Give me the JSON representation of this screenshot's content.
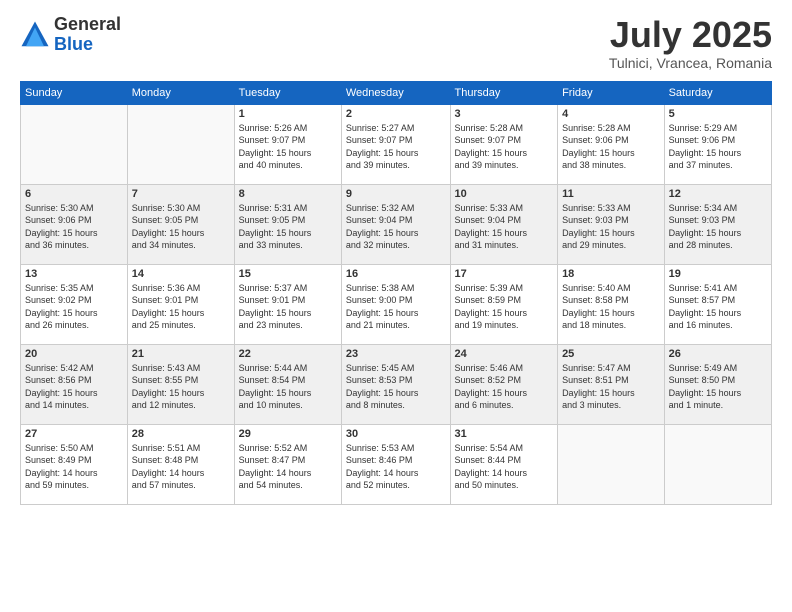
{
  "header": {
    "logo_line1": "General",
    "logo_line2": "Blue",
    "month": "July 2025",
    "location": "Tulnici, Vrancea, Romania"
  },
  "weekdays": [
    "Sunday",
    "Monday",
    "Tuesday",
    "Wednesday",
    "Thursday",
    "Friday",
    "Saturday"
  ],
  "weeks": [
    [
      {
        "day": "",
        "info": ""
      },
      {
        "day": "",
        "info": ""
      },
      {
        "day": "1",
        "info": "Sunrise: 5:26 AM\nSunset: 9:07 PM\nDaylight: 15 hours\nand 40 minutes."
      },
      {
        "day": "2",
        "info": "Sunrise: 5:27 AM\nSunset: 9:07 PM\nDaylight: 15 hours\nand 39 minutes."
      },
      {
        "day": "3",
        "info": "Sunrise: 5:28 AM\nSunset: 9:07 PM\nDaylight: 15 hours\nand 39 minutes."
      },
      {
        "day": "4",
        "info": "Sunrise: 5:28 AM\nSunset: 9:06 PM\nDaylight: 15 hours\nand 38 minutes."
      },
      {
        "day": "5",
        "info": "Sunrise: 5:29 AM\nSunset: 9:06 PM\nDaylight: 15 hours\nand 37 minutes."
      }
    ],
    [
      {
        "day": "6",
        "info": "Sunrise: 5:30 AM\nSunset: 9:06 PM\nDaylight: 15 hours\nand 36 minutes."
      },
      {
        "day": "7",
        "info": "Sunrise: 5:30 AM\nSunset: 9:05 PM\nDaylight: 15 hours\nand 34 minutes."
      },
      {
        "day": "8",
        "info": "Sunrise: 5:31 AM\nSunset: 9:05 PM\nDaylight: 15 hours\nand 33 minutes."
      },
      {
        "day": "9",
        "info": "Sunrise: 5:32 AM\nSunset: 9:04 PM\nDaylight: 15 hours\nand 32 minutes."
      },
      {
        "day": "10",
        "info": "Sunrise: 5:33 AM\nSunset: 9:04 PM\nDaylight: 15 hours\nand 31 minutes."
      },
      {
        "day": "11",
        "info": "Sunrise: 5:33 AM\nSunset: 9:03 PM\nDaylight: 15 hours\nand 29 minutes."
      },
      {
        "day": "12",
        "info": "Sunrise: 5:34 AM\nSunset: 9:03 PM\nDaylight: 15 hours\nand 28 minutes."
      }
    ],
    [
      {
        "day": "13",
        "info": "Sunrise: 5:35 AM\nSunset: 9:02 PM\nDaylight: 15 hours\nand 26 minutes."
      },
      {
        "day": "14",
        "info": "Sunrise: 5:36 AM\nSunset: 9:01 PM\nDaylight: 15 hours\nand 25 minutes."
      },
      {
        "day": "15",
        "info": "Sunrise: 5:37 AM\nSunset: 9:01 PM\nDaylight: 15 hours\nand 23 minutes."
      },
      {
        "day": "16",
        "info": "Sunrise: 5:38 AM\nSunset: 9:00 PM\nDaylight: 15 hours\nand 21 minutes."
      },
      {
        "day": "17",
        "info": "Sunrise: 5:39 AM\nSunset: 8:59 PM\nDaylight: 15 hours\nand 19 minutes."
      },
      {
        "day": "18",
        "info": "Sunrise: 5:40 AM\nSunset: 8:58 PM\nDaylight: 15 hours\nand 18 minutes."
      },
      {
        "day": "19",
        "info": "Sunrise: 5:41 AM\nSunset: 8:57 PM\nDaylight: 15 hours\nand 16 minutes."
      }
    ],
    [
      {
        "day": "20",
        "info": "Sunrise: 5:42 AM\nSunset: 8:56 PM\nDaylight: 15 hours\nand 14 minutes."
      },
      {
        "day": "21",
        "info": "Sunrise: 5:43 AM\nSunset: 8:55 PM\nDaylight: 15 hours\nand 12 minutes."
      },
      {
        "day": "22",
        "info": "Sunrise: 5:44 AM\nSunset: 8:54 PM\nDaylight: 15 hours\nand 10 minutes."
      },
      {
        "day": "23",
        "info": "Sunrise: 5:45 AM\nSunset: 8:53 PM\nDaylight: 15 hours\nand 8 minutes."
      },
      {
        "day": "24",
        "info": "Sunrise: 5:46 AM\nSunset: 8:52 PM\nDaylight: 15 hours\nand 6 minutes."
      },
      {
        "day": "25",
        "info": "Sunrise: 5:47 AM\nSunset: 8:51 PM\nDaylight: 15 hours\nand 3 minutes."
      },
      {
        "day": "26",
        "info": "Sunrise: 5:49 AM\nSunset: 8:50 PM\nDaylight: 15 hours\nand 1 minute."
      }
    ],
    [
      {
        "day": "27",
        "info": "Sunrise: 5:50 AM\nSunset: 8:49 PM\nDaylight: 14 hours\nand 59 minutes."
      },
      {
        "day": "28",
        "info": "Sunrise: 5:51 AM\nSunset: 8:48 PM\nDaylight: 14 hours\nand 57 minutes."
      },
      {
        "day": "29",
        "info": "Sunrise: 5:52 AM\nSunset: 8:47 PM\nDaylight: 14 hours\nand 54 minutes."
      },
      {
        "day": "30",
        "info": "Sunrise: 5:53 AM\nSunset: 8:46 PM\nDaylight: 14 hours\nand 52 minutes."
      },
      {
        "day": "31",
        "info": "Sunrise: 5:54 AM\nSunset: 8:44 PM\nDaylight: 14 hours\nand 50 minutes."
      },
      {
        "day": "",
        "info": ""
      },
      {
        "day": "",
        "info": ""
      }
    ]
  ]
}
